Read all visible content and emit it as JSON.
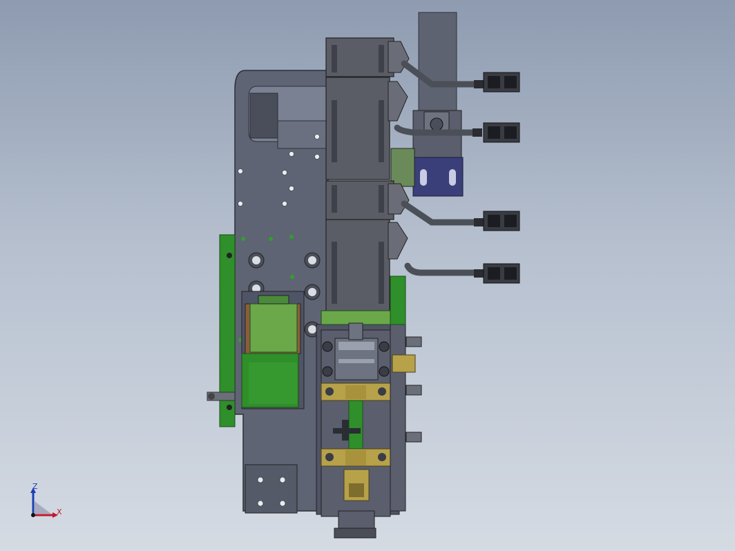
{
  "view": {
    "background_top": "#8e9bb0",
    "background_bottom": "#d5dbe3",
    "model": "machine-assembly-3d-view"
  },
  "triad": {
    "z_label": "Z",
    "x_label": "X",
    "z_color": "#1d3fb5",
    "x_color": "#c0182a"
  },
  "colors": {
    "frame": "#5f6474",
    "frame_dark": "#3f4350",
    "motor": "#5b5d66",
    "pcb": "#2f8f2a",
    "pcb_light": "#6aa84a",
    "brass": "#b7a24a",
    "bracket_blue": "#3a3f7a",
    "cable": "#4b4f57"
  },
  "icons": [
    "axis-triad-icon",
    "connector-icon",
    "stepper-motor-icon"
  ]
}
